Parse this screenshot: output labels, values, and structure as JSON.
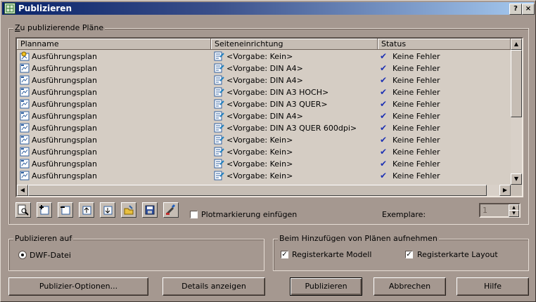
{
  "window": {
    "title": "Publizieren",
    "help_glyph": "?",
    "close_glyph": "×"
  },
  "sheets_group": {
    "label": "Zu publizierende Pläne"
  },
  "columns": {
    "planname": "Planname",
    "setup": "Seiteneinrichtung",
    "status": "Status"
  },
  "rows": [
    {
      "name": "Ausführungsplan",
      "setup": "<Vorgabe: Kein>",
      "status": "Keine Fehler",
      "icon": "model-sheet-icon"
    },
    {
      "name": "Ausführungsplan",
      "setup": "<Vorgabe: DIN A4>",
      "status": "Keine Fehler",
      "icon": "layout-sheet-icon"
    },
    {
      "name": "Ausführungsplan",
      "setup": "<Vorgabe: DIN A4>",
      "status": "Keine Fehler",
      "icon": "layout-sheet-icon"
    },
    {
      "name": "Ausführungsplan",
      "setup": "<Vorgabe: DIN A3 HOCH>",
      "status": "Keine Fehler",
      "icon": "layout-sheet-icon"
    },
    {
      "name": "Ausführungsplan",
      "setup": "<Vorgabe: DIN A3 QUER>",
      "status": "Keine Fehler",
      "icon": "layout-sheet-icon"
    },
    {
      "name": "Ausführungsplan",
      "setup": "<Vorgabe: DIN A4>",
      "status": "Keine Fehler",
      "icon": "layout-sheet-icon"
    },
    {
      "name": "Ausführungsplan",
      "setup": "<Vorgabe: DIN A3 QUER 600dpi>",
      "status": "Keine Fehler",
      "icon": "layout-sheet-icon"
    },
    {
      "name": "Ausführungsplan",
      "setup": "<Vorgabe: Kein>",
      "status": "Keine Fehler",
      "icon": "layout-sheet-icon"
    },
    {
      "name": "Ausführungsplan",
      "setup": "<Vorgabe: Kein>",
      "status": "Keine Fehler",
      "icon": "layout-sheet-icon"
    },
    {
      "name": "Ausführungsplan",
      "setup": "<Vorgabe: Kein>",
      "status": "Keine Fehler",
      "icon": "layout-sheet-icon"
    },
    {
      "name": "Ausführungsplan",
      "setup": "<Vorgabe: Kein>",
      "status": "Keine Fehler",
      "icon": "layout-sheet-icon"
    }
  ],
  "toolbar": {
    "buttons": [
      "preview-icon",
      "add-sheets-icon",
      "remove-sheets-icon",
      "move-up-icon",
      "move-down-icon",
      "load-list-icon",
      "save-list-icon",
      "plot-stamp-settings-icon"
    ],
    "plotstamp_label": "Plotmarkierung einfügen",
    "copies_label": "Exemplare:",
    "copies_value": "1"
  },
  "publish_to": {
    "label": "Publizieren auf",
    "option": "DWF-Datei"
  },
  "include": {
    "label": "Beim Hinzufügen von Plänen aufnehmen",
    "model": "Registerkarte Modell",
    "layout": "Registerkarte Layout"
  },
  "buttons": {
    "options": "Publizier-Optionen...",
    "details": "Details anzeigen",
    "publish": "Publizieren",
    "cancel": "Abbrechen",
    "help": "Hilfe"
  },
  "colors": {
    "check_blue": "#1e32b4",
    "dialog_bg": "#a59890",
    "list_bg": "#d5cdc4"
  }
}
